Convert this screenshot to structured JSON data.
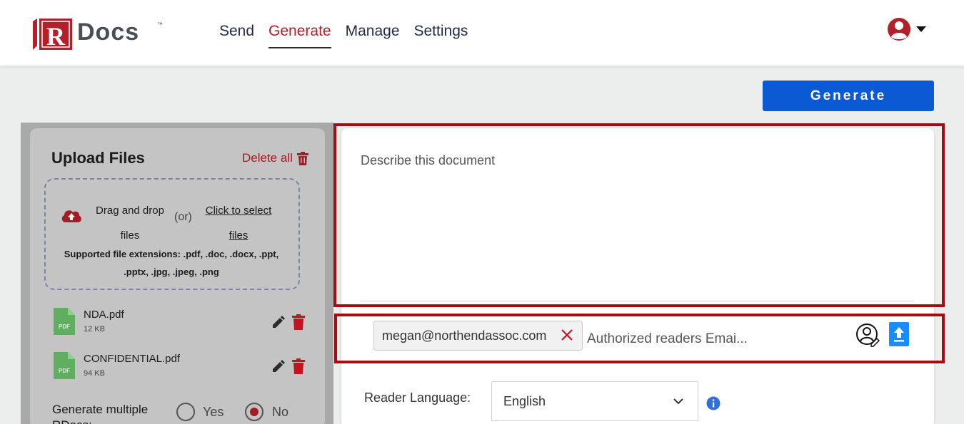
{
  "brand": {
    "logo_letter": "R",
    "logo_text": "Docs",
    "logo_tm": "™",
    "brand_red": "#b3202a"
  },
  "nav": {
    "items": [
      {
        "label": "Send",
        "active": false
      },
      {
        "label": "Generate",
        "active": true
      },
      {
        "label": "Manage",
        "active": false
      },
      {
        "label": "Settings",
        "active": false
      }
    ]
  },
  "user_menu": {
    "icon": "user-circle-icon",
    "caret": "caret-down-icon"
  },
  "actions": {
    "generate_label": "Generate",
    "generate_color": "#0b5ad4"
  },
  "upload": {
    "title": "Upload Files",
    "delete_all_label": "Delete all",
    "drag_drop_label": "Drag and drop files",
    "or_label": "(or)",
    "click_select_label": "Click to select files",
    "supported_label": "Supported file extensions: .pdf, .doc, .docx, .ppt, .pptx, .jpg, .jpeg, .png",
    "files": [
      {
        "name": "NDA.pdf",
        "size": "12 KB",
        "type_label": "PDF"
      },
      {
        "name": "CONFIDENTIAL.pdf",
        "size": "94 KB",
        "type_label": "PDF"
      }
    ],
    "multiple_label": "Generate multiple RDocs:",
    "multiple_options": [
      {
        "label": "Yes",
        "checked": false
      },
      {
        "label": "No",
        "checked": true
      }
    ]
  },
  "document": {
    "description_placeholder": "Describe this document",
    "description_value": ""
  },
  "readers": {
    "emails": [
      "megan@northendassoc.com"
    ],
    "email_placeholder": "Authorized readers Email",
    "email_placeholder_display": "Authorized readers Emai..."
  },
  "language": {
    "label": "Reader Language:",
    "selected": "English"
  }
}
